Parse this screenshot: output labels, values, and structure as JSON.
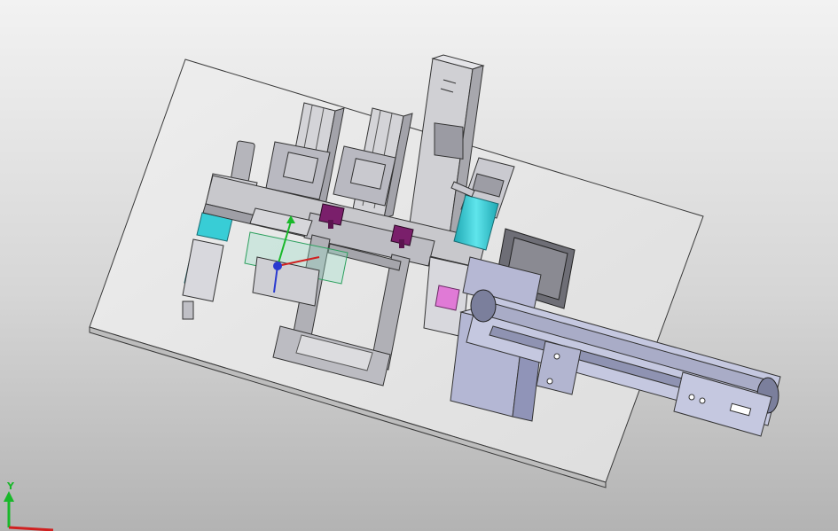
{
  "viewport": {
    "background_top": "#f2f2f2",
    "background_bottom": "#b3b3b3"
  },
  "model": {
    "base_plate_color": "#e6e6e6",
    "metal_color": "#c4c4c8",
    "frame_color": "#a8a8a8",
    "motor_color": "#b4b7d4",
    "accent_cyan": "#38cdd6",
    "accent_magenta": "#7a1f6b",
    "accent_pink": "#e07ad6",
    "outline_color": "#3a3a3a"
  },
  "triad": {
    "y_label": "Y",
    "y_color": "#19b82a",
    "x_color": "#d02020"
  }
}
